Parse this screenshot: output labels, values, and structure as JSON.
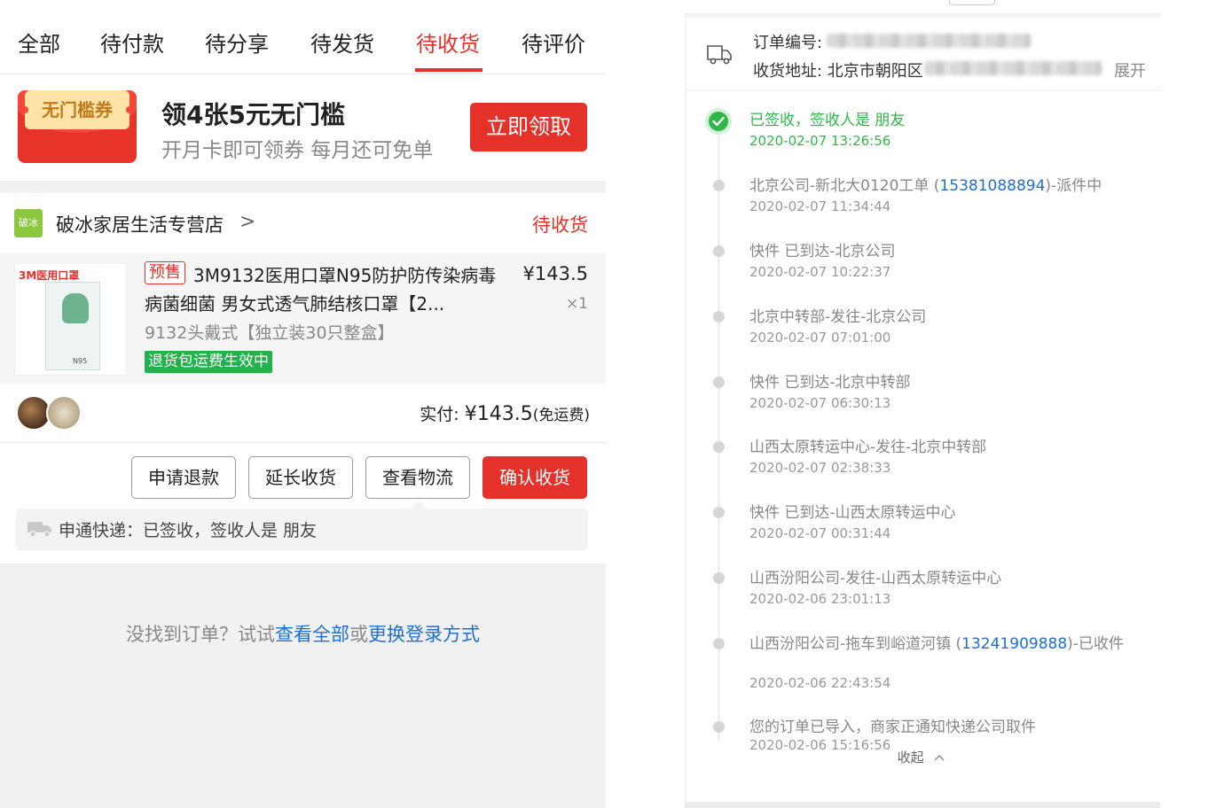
{
  "tabs": [
    {
      "label": "全部"
    },
    {
      "label": "待付款"
    },
    {
      "label": "待分享"
    },
    {
      "label": "待发货"
    },
    {
      "label": "待收货"
    },
    {
      "label": "待评价"
    }
  ],
  "active_tab": "待收货",
  "promo": {
    "coupon_label": "无门槛券",
    "title": "领4张5元无门槛",
    "subtitle": "开月卡即可领券 每月还可免单",
    "button": "立即领取"
  },
  "order": {
    "shop_logo_text": "破冰",
    "shop_name": "破冰家居生活专营店",
    "shop_chevron": ">",
    "status": "待收货",
    "product": {
      "image_brand": "3M医用口罩",
      "image_label": "N95",
      "presale_tag": "预售",
      "title": "3M9132医用口罩N95防护防传染病毒病菌细菌 男女式透气肺结核口罩【2...",
      "price": "¥143.5",
      "quantity": "×1",
      "sku": "9132头戴式【独立装30只整盒】",
      "badge": "退货包运费生效中"
    },
    "payment": {
      "label": "实付: ",
      "amount": "¥143.5",
      "note": "(免运费)"
    },
    "actions": {
      "refund": "申请退款",
      "extend": "延长收货",
      "logistics": "查看物流",
      "confirm": "确认收货"
    },
    "logistics_summary": "申通快递：已签收，签收人是 朋友"
  },
  "not_found": {
    "prefix": "没找到订单？试试",
    "link1": "查看全部",
    "middle": "或",
    "link2": "更换登录方式"
  },
  "tracking": {
    "order_no_label": "订单编号:",
    "address_label": "收货地址: 北京市朝阳区",
    "expand": "展开",
    "collapse": "收起",
    "events": [
      {
        "text": "已签收，签收人是 朋友",
        "time": "2020-02-07 13:26:56",
        "done": true
      },
      {
        "pre": "北京公司-新北大0120工单 (",
        "phone": "15381088894",
        "post": ")-派件中",
        "time": "2020-02-07 11:34:44"
      },
      {
        "text": "快件 已到达-北京公司",
        "time": "2020-02-07 10:22:37"
      },
      {
        "text": "北京中转部-发往-北京公司",
        "time": "2020-02-07 07:01:00"
      },
      {
        "text": "快件 已到达-北京中转部",
        "time": "2020-02-07 06:30:13"
      },
      {
        "text": "山西太原转运中心-发往-北京中转部",
        "time": "2020-02-07 02:38:33"
      },
      {
        "text": "快件 已到达-山西太原转运中心",
        "time": "2020-02-07 00:31:44"
      },
      {
        "text": "山西汾阳公司-发往-山西太原转运中心",
        "time": "2020-02-06 23:01:13"
      },
      {
        "pre": "山西汾阳公司-拖车到峪道河镇 (",
        "phone": "13241909888",
        "post": ")-已收件",
        "time": "2020-02-06 22:43:54"
      },
      {
        "text": "您的订单已导入，商家正通知快递公司取件",
        "time": "2020-02-06 15:16:56"
      }
    ]
  },
  "colors": {
    "accent": "#e4312a",
    "success": "#2fb84a",
    "link": "#1d6fd6"
  }
}
